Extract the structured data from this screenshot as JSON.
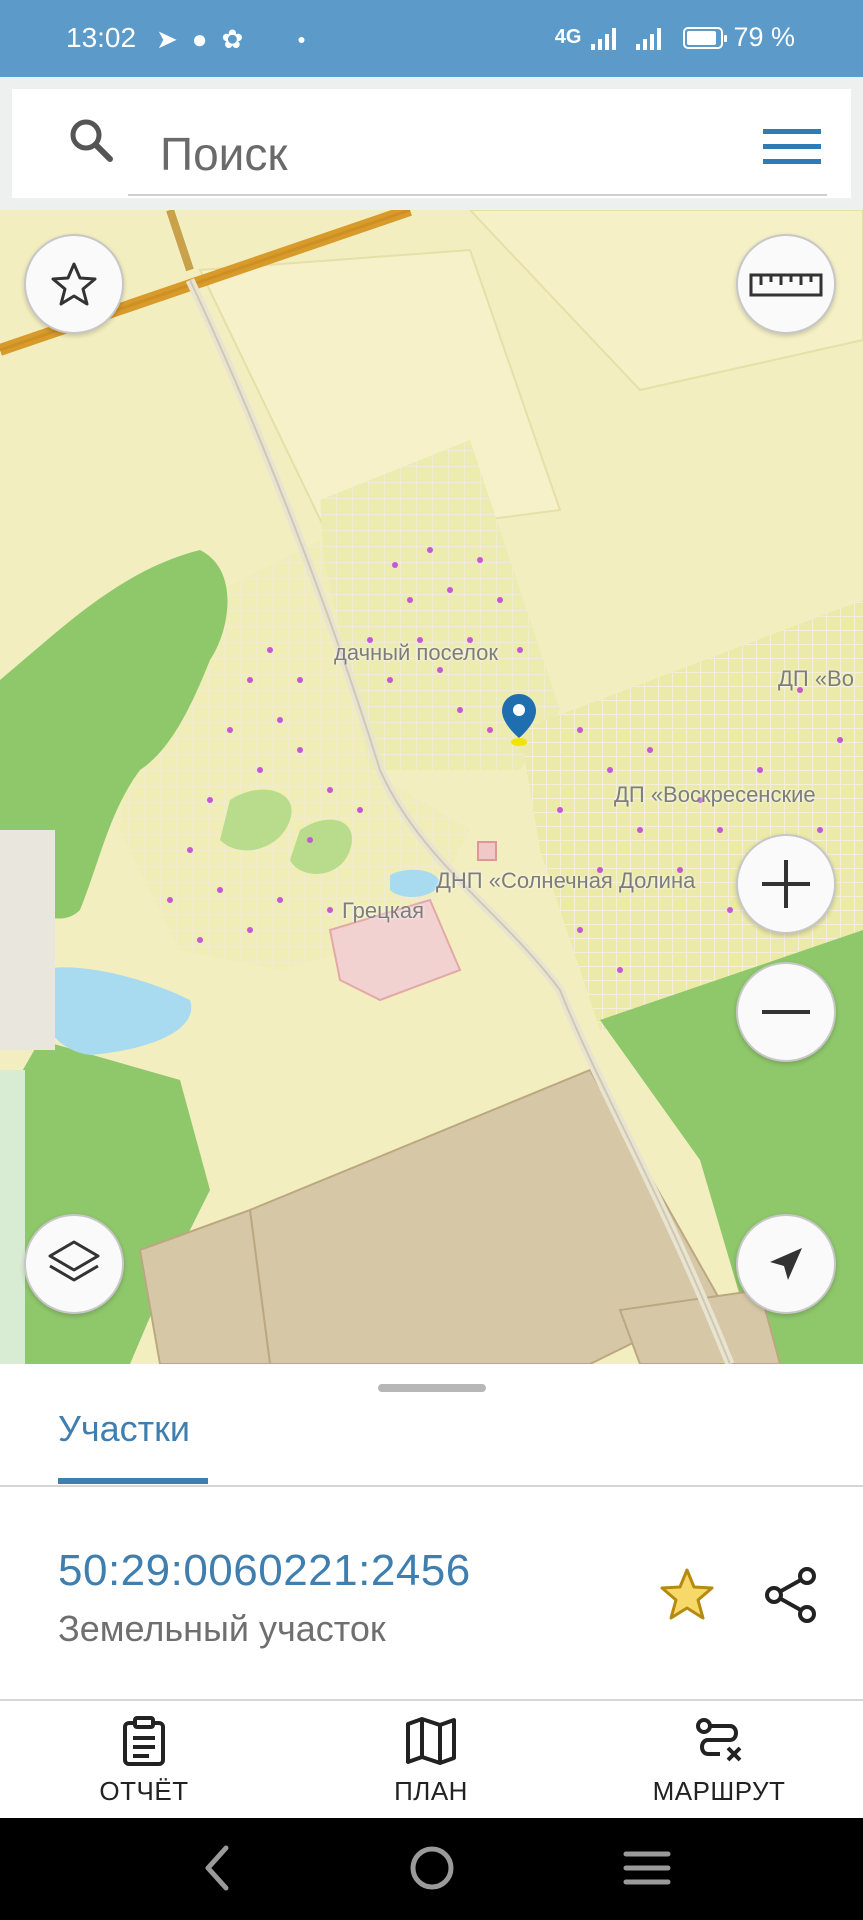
{
  "status_bar": {
    "time": "13:02",
    "network": "4G",
    "battery": "79 %",
    "battery_level": 0.79,
    "icons": [
      "telegram-icon",
      "speed-icon",
      "app-icon",
      "dot-icon"
    ]
  },
  "search": {
    "placeholder": "Поиск"
  },
  "map": {
    "labels": {
      "dacha": "дачный поселок",
      "dp_vo": "ДП «Во",
      "dp_voskresenskie": "ДП «Воскресенские",
      "dnp_solnechnaya": "ДНП «Солнечная Долина",
      "gretskaya": "Грецкая"
    }
  },
  "sheet": {
    "tab": "Участки",
    "parcel_id": "50:29:0060221:2456",
    "parcel_type": "Земельный участок",
    "actions": {
      "report": "ОТЧЁТ",
      "plan": "ПЛАН",
      "route": "МАРШРУТ"
    }
  },
  "colors": {
    "accent": "#3f7fb0",
    "status_bar": "#5b9ac9",
    "star": "#e8c23a"
  }
}
